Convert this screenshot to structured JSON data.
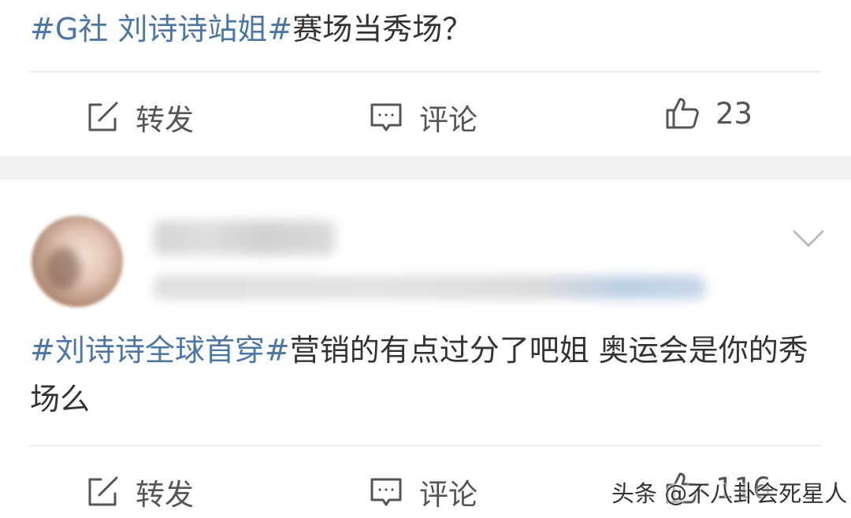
{
  "post1": {
    "hashtag": "#G社 刘诗诗站姐#",
    "text": "赛场当秀场？",
    "actions": {
      "repost_label": "转发",
      "comment_label": "评论",
      "like_count": "23"
    }
  },
  "post2": {
    "hashtag": "#刘诗诗全球首穿#",
    "text": "营销的有点过分了吧姐 奥运会是你的秀场么",
    "actions": {
      "repost_label": "转发",
      "comment_label": "评论",
      "like_count": "116"
    }
  },
  "watermark": "头条 @不八卦会死星人",
  "icons": [
    "edit-icon",
    "comment-icon",
    "like-icon",
    "chevron-down-icon"
  ],
  "colors": {
    "hashtag": "#4a76a8",
    "text": "#333333",
    "icon": "#555555",
    "background": "#f2f2f2"
  }
}
